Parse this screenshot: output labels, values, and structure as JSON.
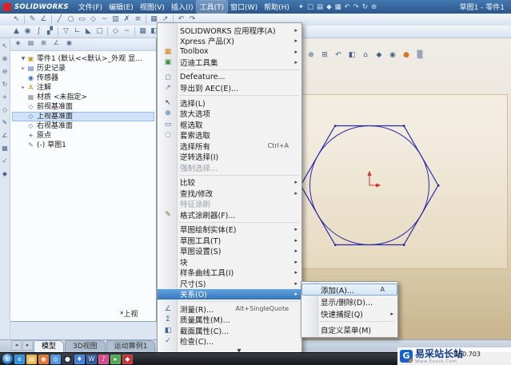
{
  "window": {
    "logo_text": "SOLIDWORKS",
    "doc_title": "草图1 - 零件1",
    "menus": [
      {
        "label": "文件(F)",
        "name": "menu-file"
      },
      {
        "label": "编辑(E)",
        "name": "menu-edit"
      },
      {
        "label": "视图(V)",
        "name": "menu-view"
      },
      {
        "label": "插入(I)",
        "name": "menu-insert"
      },
      {
        "label": "工具(T)",
        "name": "menu-tools",
        "active": true
      },
      {
        "label": "窗口(W)",
        "name": "menu-window"
      },
      {
        "label": "帮助(H)",
        "name": "menu-help"
      }
    ],
    "quick_icons": [
      {
        "name": "pin-icon",
        "glyph": "✦",
        "color": "#f6c945"
      },
      {
        "name": "new-file-icon",
        "glyph": "□"
      },
      {
        "name": "open-file-icon",
        "glyph": "▤"
      },
      {
        "name": "save-icon",
        "glyph": "◆"
      },
      {
        "name": "print-icon",
        "glyph": "▦"
      },
      {
        "name": "undo-icon",
        "glyph": "↶"
      },
      {
        "name": "redo-icon",
        "glyph": "↷"
      },
      {
        "name": "rebuild-icon",
        "glyph": "↻"
      },
      {
        "name": "options-icon",
        "glyph": "⊛"
      }
    ]
  },
  "toolbar_row1": [
    {
      "name": "select-tool-icon",
      "glyph": "↖"
    },
    {
      "type": "separator"
    },
    {
      "name": "sketch-tool-icon",
      "glyph": "✎"
    },
    {
      "name": "smart-dimension-icon",
      "glyph": "∠"
    },
    {
      "type": "separator"
    },
    {
      "name": "line-icon",
      "glyph": "╱"
    },
    {
      "name": "circle-icon",
      "glyph": "○"
    },
    {
      "name": "rectangle-icon",
      "glyph": "▭"
    },
    {
      "name": "polygon-icon",
      "glyph": "◇"
    },
    {
      "name": "spline-icon",
      "glyph": "~"
    },
    {
      "name": "mirror-entities-icon",
      "glyph": "▥"
    },
    {
      "name": "trim-entities-icon",
      "glyph": "✗"
    },
    {
      "name": "offset-entities-icon",
      "glyph": "≡"
    },
    {
      "type": "separator"
    },
    {
      "name": "linear-pattern-icon",
      "glyph": "▦"
    },
    {
      "name": "move-entities-icon",
      "glyph": "↗"
    },
    {
      "type": "separator"
    },
    {
      "name": "undo-icon",
      "glyph": "↶"
    },
    {
      "name": "redo-icon",
      "glyph": "↷"
    }
  ],
  "toolbar_row2": [
    {
      "name": "extrude-boss-icon",
      "glyph": "▲"
    },
    {
      "name": "revolve-boss-icon",
      "glyph": "◉"
    },
    {
      "name": "swept-boss-icon",
      "glyph": "∫"
    },
    {
      "name": "lofted-boss-icon",
      "glyph": "▞"
    },
    {
      "type": "separator"
    },
    {
      "name": "extruded-cut-icon",
      "glyph": "▽"
    },
    {
      "name": "fillet-icon",
      "glyph": "∟"
    },
    {
      "name": "chamfer-icon",
      "glyph": "◣"
    },
    {
      "name": "shell-icon",
      "glyph": "▢"
    },
    {
      "type": "separator"
    },
    {
      "name": "reference-geometry-icon",
      "glyph": "◇"
    },
    {
      "name": "curves-icon",
      "glyph": "~"
    },
    {
      "type": "separator"
    },
    {
      "name": "materials-icon",
      "glyph": "▦"
    },
    {
      "name": "section-view-icon",
      "glyph": "◧"
    },
    {
      "name": "view-orientation-icon",
      "glyph": "⌂"
    },
    {
      "name": "display-style-icon",
      "glyph": "◐"
    }
  ],
  "side_toolbar": [
    {
      "name": "select-icon",
      "glyph": "↖"
    },
    {
      "name": "zoom-in-icon",
      "glyph": "⊕"
    },
    {
      "name": "zoom-out-icon",
      "glyph": "⊖"
    },
    {
      "name": "rotate-view-icon",
      "glyph": "↻"
    },
    {
      "name": "pan-icon",
      "glyph": "+"
    },
    {
      "name": "plane-icon",
      "glyph": "◇"
    },
    {
      "name": "sketch-icon",
      "glyph": "✎"
    },
    {
      "name": "dimension-icon",
      "glyph": "∠"
    },
    {
      "name": "grid-icon",
      "glyph": "▦"
    },
    {
      "name": "check-icon",
      "glyph": "✓"
    },
    {
      "name": "display-icon",
      "glyph": "◆"
    }
  ],
  "viewport": {
    "view_label": "*上视",
    "hud_icons": [
      {
        "name": "zoom-fit-icon",
        "glyph": "⊕"
      },
      {
        "name": "zoom-area-icon",
        "glyph": "⊞"
      },
      {
        "name": "previous-view-icon",
        "glyph": "↶"
      },
      {
        "name": "section-view-icon",
        "glyph": "◧"
      },
      {
        "name": "view-orientation-icon",
        "glyph": "⌂"
      },
      {
        "name": "display-style-icon",
        "glyph": "◆"
      },
      {
        "name": "hide-show-icon",
        "glyph": "◉"
      },
      {
        "name": "appearances-icon",
        "glyph": "●",
        "color": "#d2762a"
      },
      {
        "name": "scene-icon",
        "glyph": "▒"
      }
    ]
  },
  "feature_tree": {
    "tabs": [
      {
        "name": "feature-manager-tab",
        "glyph": "◈"
      },
      {
        "name": "property-manager-tab",
        "glyph": "▤"
      },
      {
        "name": "configuration-manager-tab",
        "glyph": "⊞"
      },
      {
        "name": "dimxpert-manager-tab",
        "glyph": "∠"
      },
      {
        "name": "display-manager-tab",
        "glyph": "◉"
      }
    ],
    "items": [
      {
        "label": "零件1 (默认<<默认>_外观 显...",
        "glyph": "▣",
        "color": "#c8a028",
        "caret": "▼",
        "name": "tree-item-part-root"
      },
      {
        "label": "历史记录",
        "glyph": "▤",
        "color": "#3a6ab0",
        "caret": "▸",
        "name": "tree-item-history"
      },
      {
        "label": "传感器",
        "glyph": "◉",
        "color": "#3a6ab0",
        "caret": "",
        "name": "tree-item-sensors"
      },
      {
        "label": "注解",
        "glyph": "A",
        "color": "#cc8800",
        "caret": "▸",
        "name": "tree-item-annotations"
      },
      {
        "label": "材质 <未指定>",
        "glyph": "▦",
        "color": "#888888",
        "caret": "",
        "name": "tree-item-material"
      },
      {
        "label": "前视基准面",
        "glyph": "◇",
        "color": "#4477bb",
        "caret": "",
        "name": "tree-item-front-plane"
      },
      {
        "label": "上视基准面",
        "glyph": "◇",
        "color": "#4477bb",
        "caret": "",
        "selected": true,
        "name": "tree-item-top-plane"
      },
      {
        "label": "右视基准面",
        "glyph": "◇",
        "color": "#4477bb",
        "caret": "",
        "name": "tree-item-right-plane"
      },
      {
        "label": "原点",
        "glyph": "+",
        "color": "#3355aa",
        "caret": "",
        "name": "tree-item-origin"
      },
      {
        "label": "(-) 草图1",
        "glyph": "✎",
        "color": "#777777",
        "caret": "",
        "name": "tree-item-sketch1"
      }
    ]
  },
  "tools_menu": {
    "scroll_hint": "▼",
    "items": [
      {
        "label": "SOLIDWORKS 应用程序(A)",
        "type": "submenu"
      },
      {
        "label": "Xpress 产品(X)",
        "type": "submenu"
      },
      {
        "label": "Toolbox",
        "type": "submenu",
        "glyph": "▦",
        "color": "#d08020"
      },
      {
        "label": "迈迪工具集",
        "type": "submenu",
        "glyph": "▣",
        "color": "#3a8a3a"
      },
      {
        "type": "separator"
      },
      {
        "label": "Defeature...",
        "glyph": "◻",
        "color": "#5a7a9a"
      },
      {
        "label": "导出到 AEC(E)...",
        "glyph": "↗",
        "color": "#5a7a9a"
      },
      {
        "type": "separator"
      },
      {
        "label": "选择(L)",
        "glyph": "↖",
        "color": "#333333"
      },
      {
        "label": "放大选项",
        "glyph": "⊕",
        "color": "#3a6a9a"
      },
      {
        "label": "框选取",
        "glyph": "▭",
        "color": "#3a6a9a"
      },
      {
        "label": "套索选取",
        "glyph": "◌",
        "color": "#3a6a9a"
      },
      {
        "label": "选择所有",
        "shortcut": "Ctrl+A"
      },
      {
        "label": "逆转选择(I)"
      },
      {
        "label": "强制选择...",
        "disabled": true
      },
      {
        "type": "separator"
      },
      {
        "label": "比较",
        "type": "submenu"
      },
      {
        "label": "查找/修改",
        "type": "submenu"
      },
      {
        "label": "特征涂刷",
        "disabled": true
      },
      {
        "label": "格式涂刷器(F)...",
        "glyph": "✎",
        "color": "#8a6a3a"
      },
      {
        "type": "separator"
      },
      {
        "label": "草图绘制实体(E)",
        "type": "submenu"
      },
      {
        "label": "草图工具(T)",
        "type": "submenu"
      },
      {
        "label": "草图设置(S)",
        "type": "submenu"
      },
      {
        "label": "块",
        "type": "submenu"
      },
      {
        "label": "样条曲线工具(I)",
        "type": "submenu"
      },
      {
        "label": "尺寸(S)",
        "type": "submenu"
      },
      {
        "label": "关系(O)",
        "type": "submenu",
        "highlighted": true
      },
      {
        "type": "separator"
      },
      {
        "label": "测量(R)...",
        "shortcut": "Alt+SingleQuote",
        "glyph": "∠",
        "color": "#3a6a9a"
      },
      {
        "label": "质量属性(M)...",
        "glyph": "Σ",
        "color": "#3a6a9a"
      },
      {
        "label": "截面属性(C)...",
        "glyph": "◧",
        "color": "#3a6a9a"
      },
      {
        "label": "检查(C)...",
        "glyph": "✓",
        "color": "#3a6a9a"
      }
    ]
  },
  "relations_submenu": {
    "items": [
      {
        "label": "添加(A)...",
        "shortcut": "A",
        "highlighted": true,
        "name": "submenu-item-add-relation"
      },
      {
        "label": "显示/删除(D)...",
        "name": "submenu-item-display-delete"
      },
      {
        "label": "快速捕捉(Q)",
        "type": "submenu",
        "name": "submenu-item-quick-snaps"
      },
      {
        "type": "separator"
      },
      {
        "label": "自定义菜单(M)",
        "name": "submenu-item-customize-menu"
      }
    ]
  },
  "bottom_tabs": {
    "scroll_left": "◂",
    "scroll_right": "▸",
    "tabs": [
      {
        "label": "模型",
        "selected": true,
        "name": "tab-model"
      },
      {
        "label": "3D视图",
        "name": "tab-3d-views"
      },
      {
        "label": "运动算例1",
        "name": "tab-motion-study-1"
      }
    ]
  },
  "statusbar": {
    "coordinate": "-100.703"
  },
  "taskbar": {
    "start_glyph": "⊞",
    "icons": [
      {
        "name": "ie-icon",
        "glyph": "e",
        "color": "#2f8fdc"
      },
      {
        "name": "explorer-icon",
        "glyph": "▤",
        "color": "#e8b64c"
      },
      {
        "name": "media-player-icon",
        "glyph": "◉",
        "color": "#e2702a"
      },
      {
        "name": "chrome-icon",
        "glyph": "◎",
        "color": "#4a90e2"
      },
      {
        "name": "qq-icon",
        "glyph": "●",
        "color": "#222f3a"
      },
      {
        "name": "baidu-icon",
        "glyph": "♦",
        "color": "#3f7de0"
      },
      {
        "name": "word-icon",
        "glyph": "W",
        "color": "#2b5797"
      },
      {
        "name": "music-icon",
        "glyph": "♪",
        "color": "#d4488a"
      },
      {
        "name": "video-icon",
        "glyph": "▸",
        "color": "#52a552"
      },
      {
        "name": "solidworks-task-icon",
        "glyph": "◆",
        "color": "#c23232"
      }
    ]
  },
  "watermark": {
    "logo_letter": "G",
    "title": "易采站长站",
    "subtitle": "Www.Easck.Com"
  }
}
